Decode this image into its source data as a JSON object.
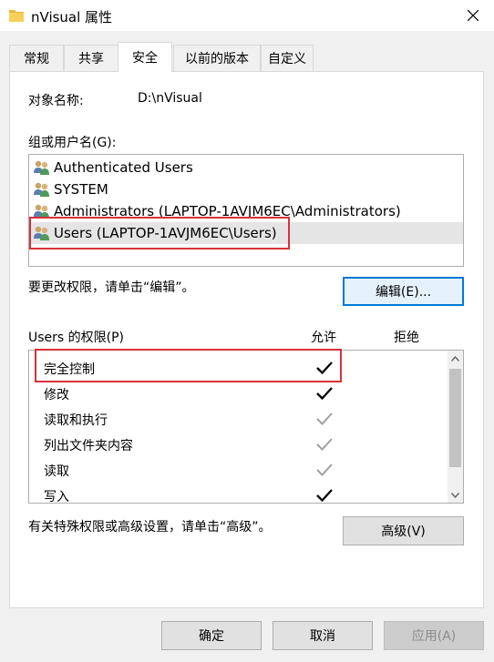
{
  "window": {
    "title": "nVisual 属性",
    "close_icon": "close-icon"
  },
  "tabs": [
    {
      "label": "常规",
      "active": false
    },
    {
      "label": "共享",
      "active": false
    },
    {
      "label": "安全",
      "active": true
    },
    {
      "label": "以前的版本",
      "active": false
    },
    {
      "label": "自定义",
      "active": false
    }
  ],
  "object": {
    "label": "对象名称:",
    "value": "D:\\nVisual"
  },
  "groups": {
    "label": "组或用户名(G):",
    "items": [
      {
        "name": "Authenticated Users",
        "selected": false
      },
      {
        "name": "SYSTEM",
        "selected": false
      },
      {
        "name": "Administrators (LAPTOP-1AVJM6EC\\Administrators)",
        "selected": false
      },
      {
        "name": "Users (LAPTOP-1AVJM6EC\\Users)",
        "selected": true
      }
    ]
  },
  "edit": {
    "hint": "要更改权限，请单击“编辑”。",
    "button": "编辑(E)..."
  },
  "permissions": {
    "label": "Users 的权限(P)",
    "allow_header": "允许",
    "deny_header": "拒绝",
    "items": [
      {
        "name": "完全控制",
        "allow": "explicit"
      },
      {
        "name": "修改",
        "allow": "explicit"
      },
      {
        "name": "读取和执行",
        "allow": "inherited"
      },
      {
        "name": "列出文件夹内容",
        "allow": "inherited"
      },
      {
        "name": "读取",
        "allow": "inherited"
      },
      {
        "name": "写入",
        "allow": "explicit"
      }
    ]
  },
  "advanced": {
    "hint": "有关特殊权限或高级设置，请单击“高级”。",
    "button": "高级(V)"
  },
  "footer": {
    "ok": "确定",
    "cancel": "取消",
    "apply": "应用(A)"
  },
  "colors": {
    "highlight": "#d9313a",
    "accent": "#0078d7",
    "check_dark": "#000000",
    "check_gray": "#a0a0a0"
  }
}
